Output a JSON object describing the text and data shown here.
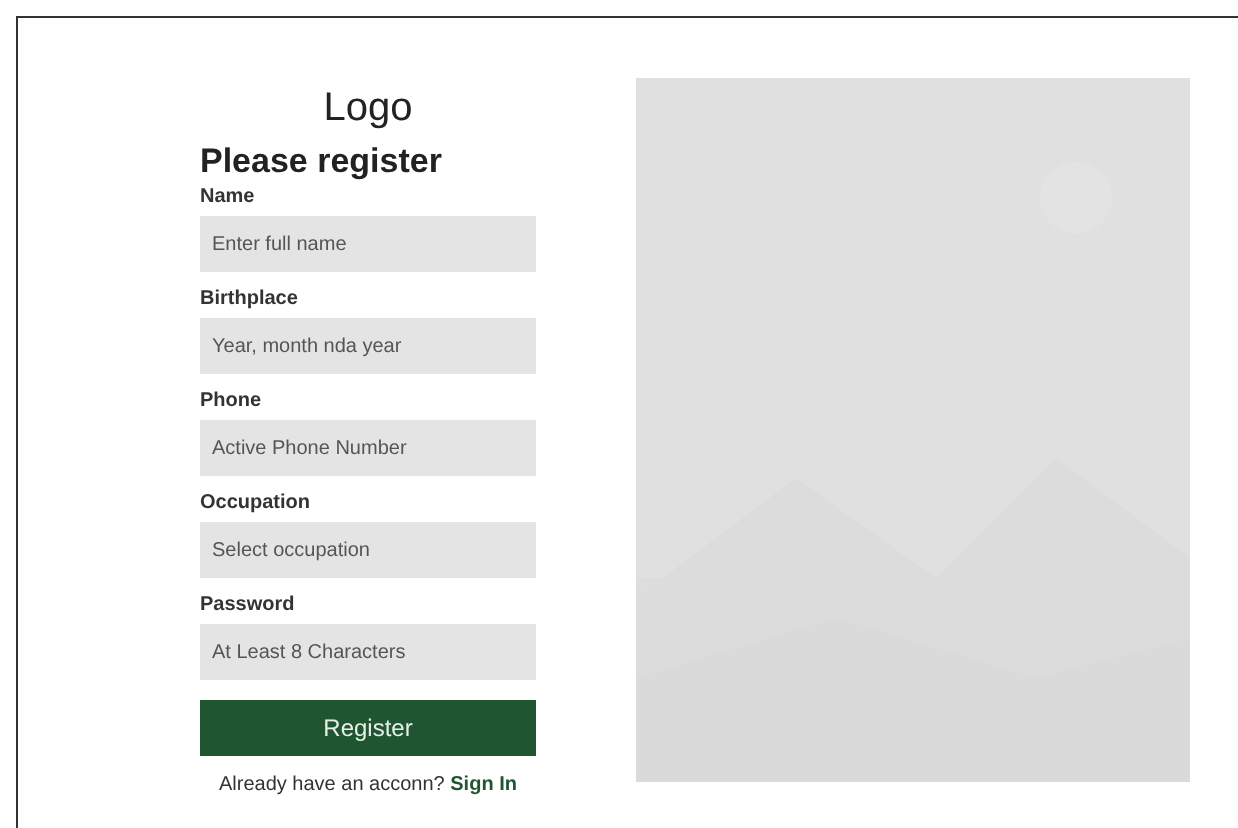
{
  "logo": "Logo",
  "heading": "Please register",
  "fields": [
    {
      "label": "Name",
      "placeholder": "Enter full name"
    },
    {
      "label": "Birthplace",
      "placeholder": "Year, month nda year"
    },
    {
      "label": "Phone",
      "placeholder": "Active Phone Number"
    },
    {
      "label": "Occupation",
      "placeholder": "Select occupation"
    },
    {
      "label": "Password",
      "placeholder": "At Least 8 Characters"
    }
  ],
  "submit": "Register",
  "signin": {
    "prompt": "Already have an acconn?",
    "link": "Sign In"
  }
}
